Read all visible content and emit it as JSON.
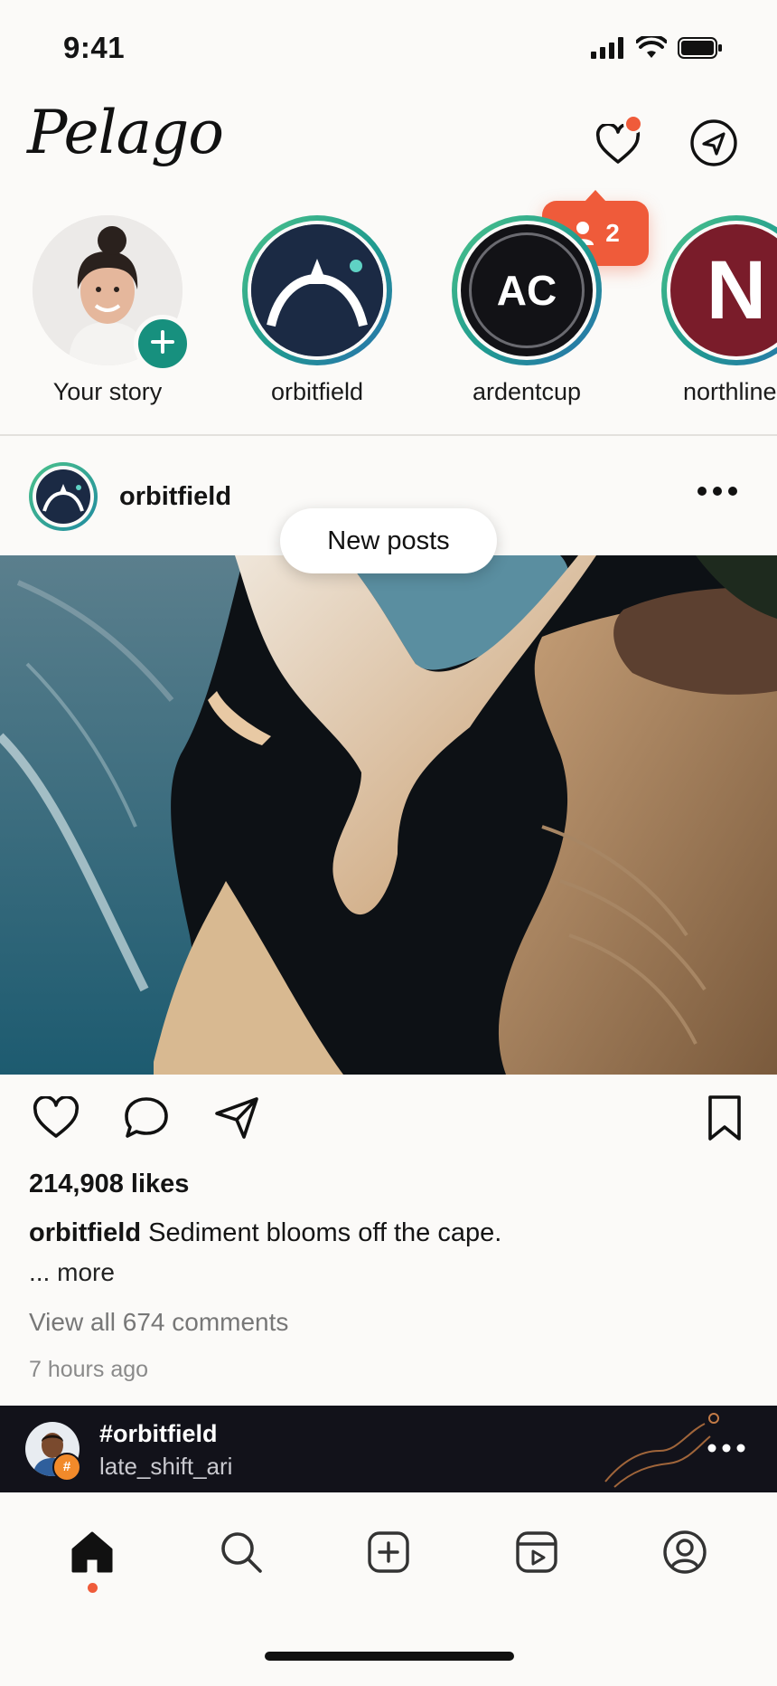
{
  "status_bar": {
    "time": "9:41"
  },
  "header": {
    "logo": "Pelago"
  },
  "activity": {
    "count": "2"
  },
  "stories": [
    {
      "label": "Your story"
    },
    {
      "label": "orbitfield"
    },
    {
      "label": "ardentcup",
      "initials": "AC"
    },
    {
      "label": "northline",
      "initials": "N"
    }
  ],
  "banner": {
    "new_posts": "New posts"
  },
  "post": {
    "username": "orbitfield",
    "likes": "214,908 likes",
    "caption_user": "orbitfield",
    "caption_text": "Sediment blooms off the cape.",
    "more": "... more",
    "comments": "View all 674 comments",
    "time": "7 hours ago"
  },
  "live_bar": {
    "hashtag": "#orbitfield",
    "user": "late_shift_ari",
    "badge": "#"
  },
  "colors": {
    "accent": "#ef5b3a",
    "teal": "#17907e",
    "ring_start": "#4cc38a",
    "ring_end": "#2a6fb0",
    "bar": "#12121a"
  },
  "icons": [
    "heart-icon",
    "send-icon",
    "plus-icon",
    "more-icon",
    "comment-icon",
    "bookmark-icon",
    "home-icon",
    "search-icon",
    "create-icon",
    "reels-icon",
    "profile-icon"
  ]
}
